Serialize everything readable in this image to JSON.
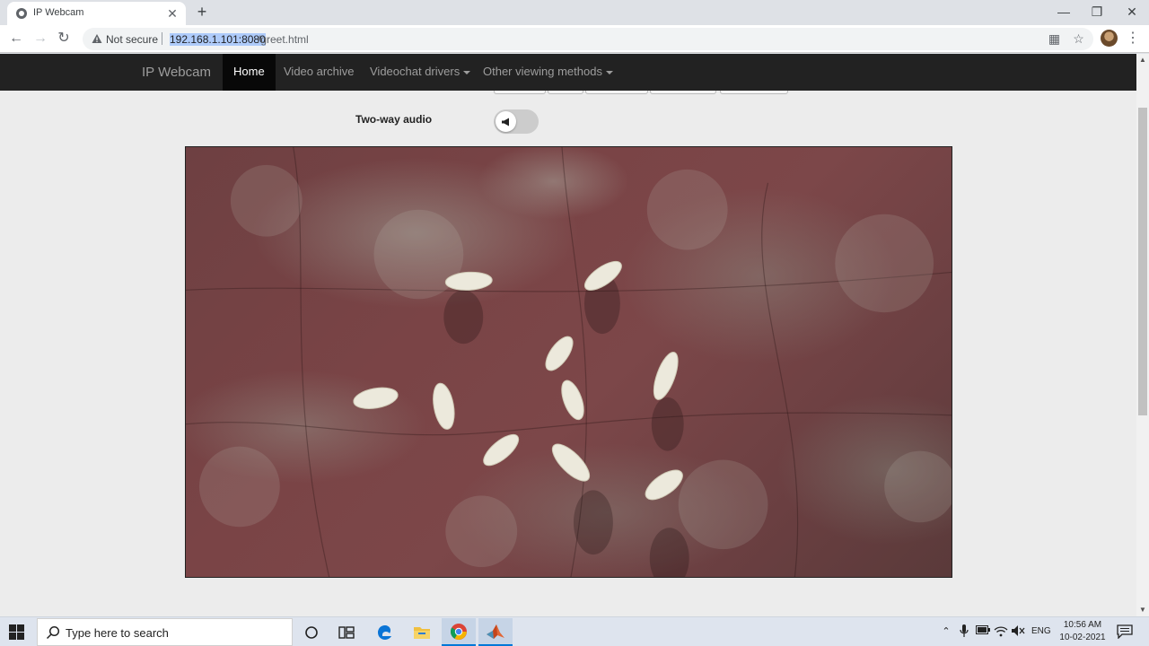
{
  "browser": {
    "tab_title": "IP Webcam",
    "not_secure": "Not secure",
    "url_host": "192.168.1.101:8080",
    "url_path": "/greet.html"
  },
  "navbar": {
    "brand": "IP Webcam",
    "items": [
      {
        "label": "Home",
        "active": true
      },
      {
        "label": "Video archive"
      },
      {
        "label": "Videochat drivers"
      },
      {
        "label": "Other viewing methods"
      }
    ]
  },
  "controls": {
    "two_way_audio_label": "Two-way audio",
    "two_way_audio_on": false
  },
  "taskbar": {
    "search_placeholder": "Type here to search",
    "language": "ENG",
    "time": "10:56 AM",
    "date": "10-02-2021",
    "apps": [
      "cortana-circle",
      "task-view",
      "edge",
      "file-explorer",
      "chrome",
      "matlab"
    ]
  }
}
